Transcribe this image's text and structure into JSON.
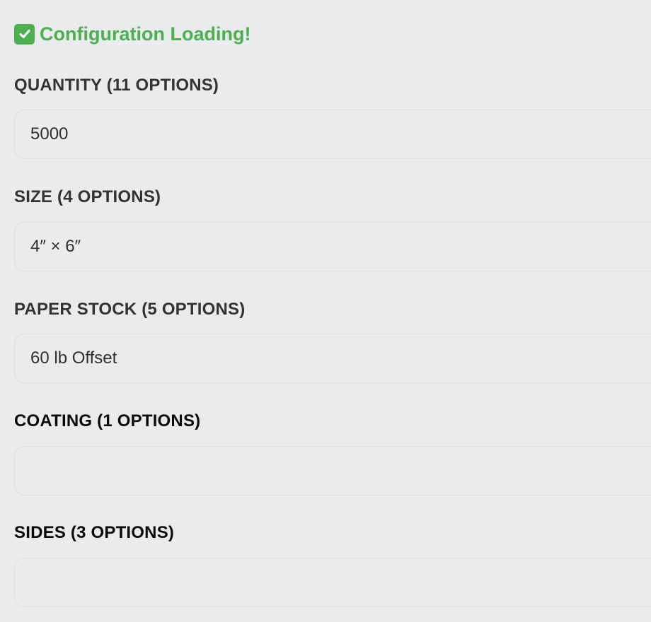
{
  "status": {
    "icon": "check-box-icon",
    "text": "Configuration Loading!",
    "color": "#4caf50"
  },
  "fields": [
    {
      "label": "QUANTITY (11 OPTIONS)",
      "value": "5000"
    },
    {
      "label": "SIZE (4 OPTIONS)",
      "value": "4″ × 6″"
    },
    {
      "label": "PAPER STOCK (5 OPTIONS)",
      "value": "60 lb Offset"
    },
    {
      "label": "COATING (1 OPTIONS)",
      "value": ""
    },
    {
      "label": "SIDES (3 OPTIONS)",
      "value": ""
    }
  ]
}
